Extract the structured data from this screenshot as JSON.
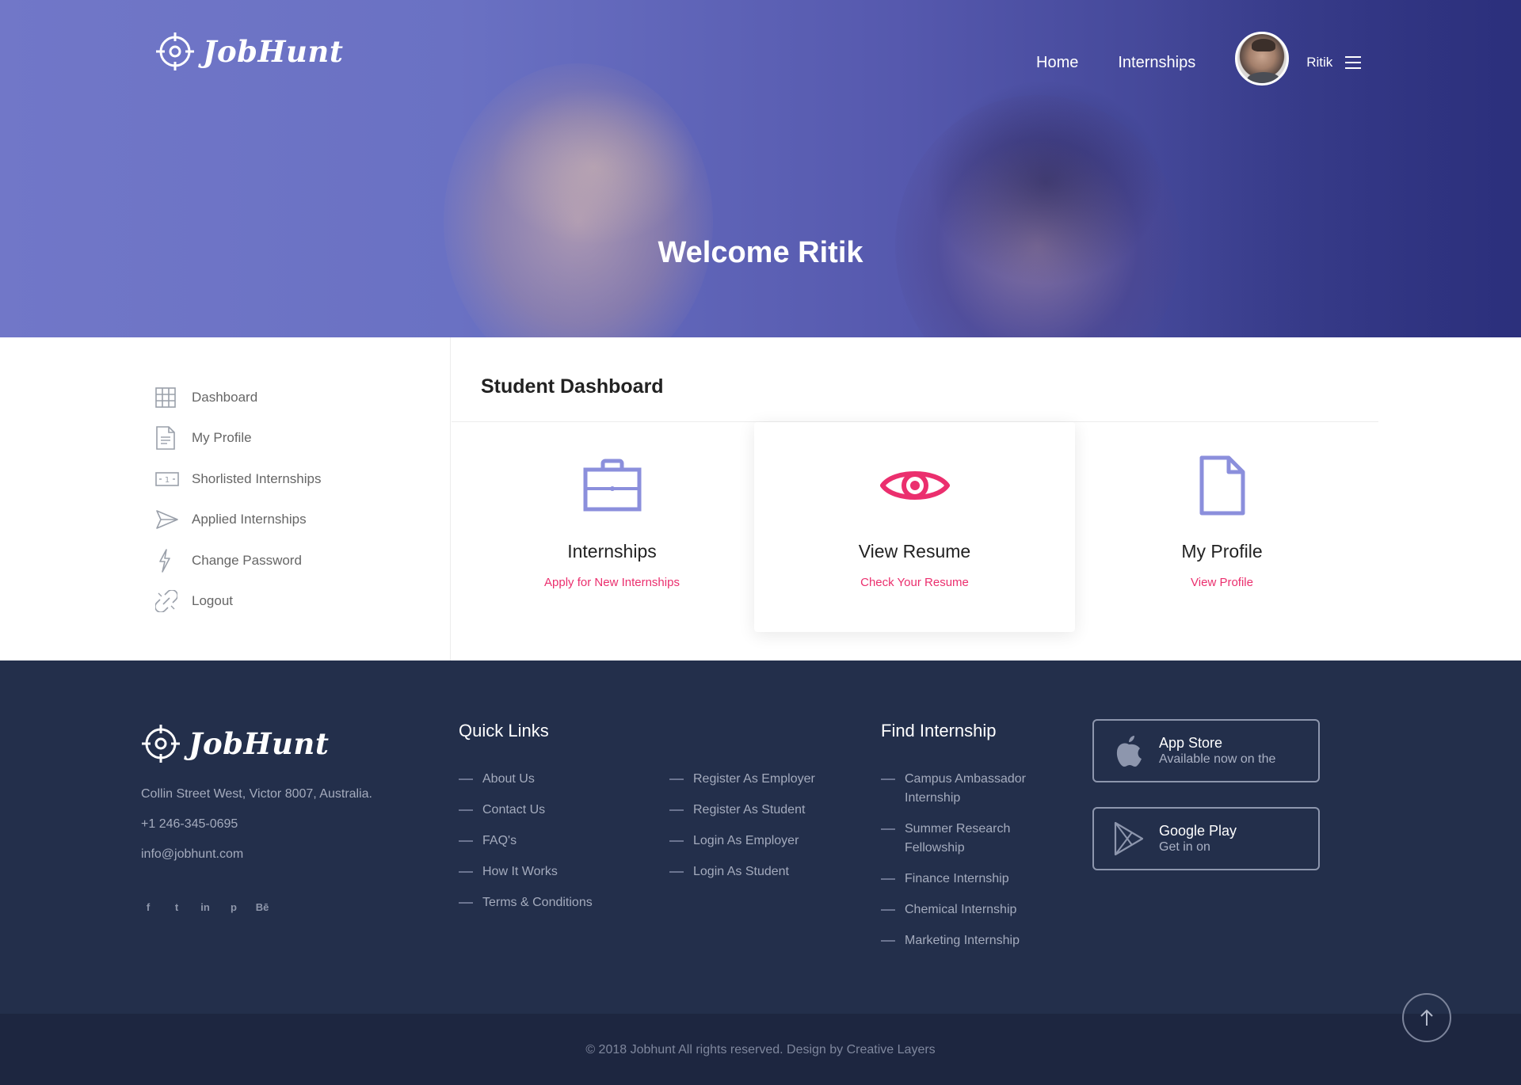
{
  "brand": {
    "name": "JobHunt"
  },
  "nav": {
    "home": "Home",
    "internships": "Internships",
    "user_name": "Ritik"
  },
  "hero": {
    "title": "Welcome Ritik"
  },
  "sidebar": {
    "items": [
      {
        "label": "Dashboard",
        "icon": "grid-icon"
      },
      {
        "label": "My Profile",
        "icon": "document-icon"
      },
      {
        "label": "Shorlisted Internships",
        "icon": "money-icon"
      },
      {
        "label": "Applied Internships",
        "icon": "paper-plane-icon"
      },
      {
        "label": "Change Password",
        "icon": "lightning-icon"
      },
      {
        "label": "Logout",
        "icon": "unlink-icon"
      }
    ]
  },
  "main": {
    "title": "Student Dashboard",
    "cards": [
      {
        "title": "Internships",
        "link": "Apply for New Internships",
        "icon": "briefcase-icon"
      },
      {
        "title": "View Resume",
        "link": "Check Your Resume",
        "icon": "eye-icon"
      },
      {
        "title": "My Profile",
        "link": "View Profile",
        "icon": "file-icon"
      }
    ]
  },
  "footer": {
    "address": "Collin Street West, Victor 8007, Australia.",
    "phone": "+1 246-345-0695",
    "email": "info@jobhunt.com",
    "social": [
      "f",
      "t",
      "in",
      "p",
      "Bē"
    ],
    "quick_links_title": "Quick Links",
    "quick_links_col1": [
      "About Us",
      "Contact Us",
      "FAQ's",
      "How It Works",
      "Terms & Conditions"
    ],
    "quick_links_col2": [
      "Register As Employer",
      "Register As Student",
      "Login As Employer",
      "Login As Student"
    ],
    "find_title": "Find Internship",
    "find_links": [
      "Campus Ambassador Internship",
      "Summer Research Fellowship",
      "Finance Internship",
      "Chemical Internship",
      "Marketing Internship"
    ],
    "app_store": {
      "title": "App Store",
      "sub": "Available now on the"
    },
    "google_play": {
      "title": "Google Play",
      "sub": "Get in on"
    },
    "copyright": "© 2018 Jobhunt All rights reserved. Design by Creative Layers"
  },
  "colors": {
    "accent": "#eb2f6e",
    "icon_purple": "#8b8fdc",
    "footer_bg": "#232f4b",
    "hero_blue": "#6a71c3"
  }
}
